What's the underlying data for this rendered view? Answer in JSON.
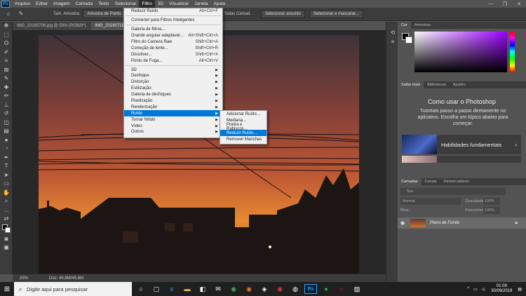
{
  "app": {
    "icon": "Ps"
  },
  "menubar": {
    "items": [
      "Arquivo",
      "Editar",
      "Imagem",
      "Camada",
      "Texto",
      "Selecionar",
      "Filtro",
      "3D",
      "Visualizar",
      "Janela",
      "Ajuda"
    ],
    "active": "Filtro"
  },
  "window_controls": [
    "—",
    "❐",
    "✕"
  ],
  "options": {
    "sample_label": "Tam. Amostra:",
    "sample_value": "Amostra de Ponto",
    "all_layers": "Mostrar Todas Camad.",
    "select_subject": "Selecionar assunto",
    "select_mask": "Selecionar e mascarar..."
  },
  "tabs": [
    {
      "label": "IMG_20190706.jpg @ 50% (RGB/8*)",
      "active": false
    },
    {
      "label": "IMG_20190711_1",
      "active": true
    }
  ],
  "filter_menu": [
    {
      "label": "Reduzir Ruído",
      "shortcut": "Alt+Ctrl+F"
    },
    {
      "sep": true
    },
    {
      "label": "Converter para Filtros Inteligentes",
      "shortcut": ""
    },
    {
      "sep": true
    },
    {
      "label": "Galeria de filtros...",
      "shortcut": ""
    },
    {
      "label": "Grande angular adaptável...",
      "shortcut": "Alt+Shift+Ctrl+A"
    },
    {
      "label": "Filtro do Camera Raw",
      "shortcut": "Shift+Ctrl+A"
    },
    {
      "label": "Correção de lente...",
      "shortcut": "Shift+Ctrl+R"
    },
    {
      "label": "Dissolver...",
      "shortcut": "Shift+Ctrl+X"
    },
    {
      "label": "Ponto de Fuga...",
      "shortcut": "Alt+Ctrl+V"
    },
    {
      "sep": true
    },
    {
      "label": "3D",
      "sub": true
    },
    {
      "label": "Desfoque",
      "sub": true
    },
    {
      "label": "Distorção",
      "sub": true
    },
    {
      "label": "Estilização",
      "sub": true
    },
    {
      "label": "Galeria de desfoques",
      "sub": true
    },
    {
      "label": "Pixelização",
      "sub": true
    },
    {
      "label": "Renderização",
      "sub": true
    },
    {
      "label": "Ruído",
      "sub": true,
      "selected": true
    },
    {
      "label": "Tornar Nítido",
      "sub": true
    },
    {
      "label": "Vídeo",
      "sub": true
    },
    {
      "label": "Outros",
      "sub": true
    }
  ],
  "noise_submenu": [
    {
      "label": "Adicionar Ruído..."
    },
    {
      "label": "Mediana..."
    },
    {
      "label": "Poeira e Rabiscos..."
    },
    {
      "label": "Reduzir Ruído...",
      "selected": true
    },
    {
      "label": "Remover Manchas"
    }
  ],
  "status": {
    "zoom": "25%",
    "doc": "Doc: 45,6M/45,6M"
  },
  "color_panel": {
    "tabs": [
      "Cor",
      "Amostras"
    ]
  },
  "learn_panel": {
    "tabs": [
      "Saiba mais",
      "Bibliotecas",
      "Ajustes"
    ],
    "title": "Como usar o Photoshop",
    "desc": "Tutoriais passo a passo diretamente no aplicativo. Escolha um tópico abaixo para começar.",
    "card": "Habilidades fundamentais"
  },
  "layers_panel": {
    "tabs": [
      "Camadas",
      "Canais",
      "Demarcadores"
    ],
    "kind": "Tipo",
    "blend": "Normal",
    "opacity_label": "Opacidade:",
    "opacity": "100%",
    "lock_label": "Bloq.:",
    "fill_label": "Preenchimento:",
    "fill": "100%",
    "layer_name": "Plano de Fundo"
  },
  "taskbar": {
    "search_placeholder": "Digite aqui para pesquisar",
    "time": "01:09",
    "date": "30/09/2019"
  },
  "colors": {
    "menu_select": "#0078d7",
    "sky_top": "#4a3a3e",
    "sky_mid": "#b5553a",
    "sky_bottom": "#e8882f"
  }
}
